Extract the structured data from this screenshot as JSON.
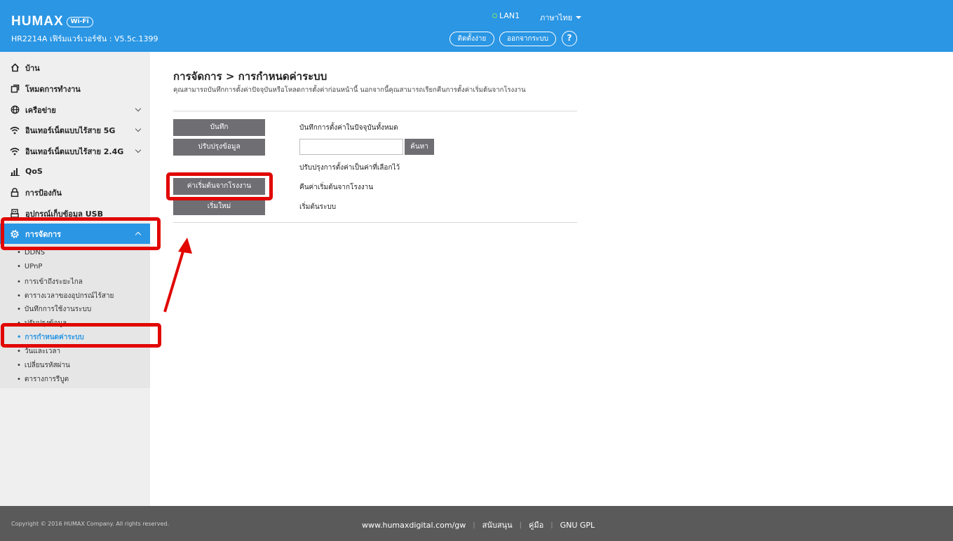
{
  "header": {
    "brand": "HUMAX",
    "brand_badge": "Wi-Fi",
    "firmware": "HR2214A เฟิร์มแวร์เวอร์ชัน : V5.5c.1399",
    "lan_status": "LAN1",
    "language": "ภาษาไทย",
    "setup_label": "ติดตั้งง่าย",
    "logout_label": "ออกจากระบบ",
    "help_label": "?"
  },
  "sidebar": {
    "items": [
      {
        "label": "บ้าน",
        "icon": "home-icon"
      },
      {
        "label": "โหมดการทำงาน",
        "icon": "mode-icon"
      },
      {
        "label": "เครือข่าย",
        "icon": "globe-icon"
      },
      {
        "label": "อินเทอร์เน็ตแบบไร้สาย 5G",
        "icon": "wifi-icon"
      },
      {
        "label": "อินเทอร์เน็ตแบบไร้สาย 2.4G",
        "icon": "wifi-icon"
      },
      {
        "label": "QoS",
        "icon": "bar-chart-icon"
      },
      {
        "label": "การป้องกัน",
        "icon": "lock-icon"
      },
      {
        "label": "อุปกรณ์เก็บข้อมูล USB",
        "icon": "usb-icon"
      },
      {
        "label": "การจัดการ",
        "icon": "gear-icon"
      }
    ],
    "submenu": [
      "DDNS",
      "UPnP",
      "การเข้าถึงระยะไกล",
      "ตารางเวลาของอุปกรณ์ไร้สาย",
      "บันทึกการใช้งานระบบ",
      "ปรับปรุงข้อมูล",
      "การกำหนดค่าระบบ",
      "วันและเวลา",
      "เปลี่ยนรหัสผ่าน",
      "ตารางการรีบูต"
    ]
  },
  "main": {
    "title": "การจัดการ > การกำหนดค่าระบบ",
    "description": "คุณสามารถบันทึกการตั้งค่าปัจจุบันหรือโหลดการตั้งค่าก่อนหน้านี้ นอกจากนี้คุณสามารถเรียกคืนการตั้งค่าเริ่มต้นจากโรงงาน",
    "save_label": "บันทึก",
    "save_desc": "บันทึกการตั้งค่าในปัจจุบันทั้งหมด",
    "update_label": "ปรับปรุงข้อมูล",
    "search_label": "ค้นหา",
    "update_desc": "ปรับปรุงการตั้งค่าเป็นค่าที่เลือกไว้",
    "factory_label": "ค่าเริ่มต้นจากโรงงาน",
    "factory_desc": "คืนค่าเริ่มต้นจากโรงงาน",
    "reboot_label": "เริ่มใหม่",
    "reboot_desc": "เริ่มต้นระบบ"
  },
  "footer": {
    "copyright": "Copyright © 2016 HUMAX Company. All rights reserved.",
    "website": "www.humaxdigital.com/gw",
    "support": "สนับสนุน",
    "manual": "คู่มือ",
    "gpl": "GNU GPL"
  },
  "colors": {
    "header_bg": "#2a96e4",
    "annotation_red": "#e10600",
    "button_gray": "#6e6e73"
  }
}
